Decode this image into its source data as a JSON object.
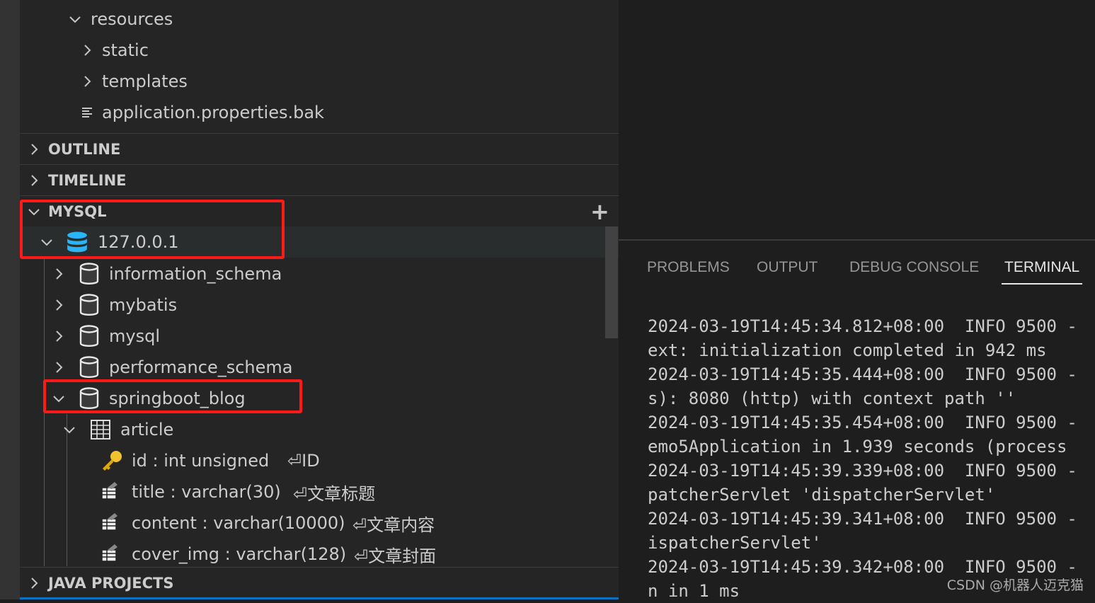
{
  "explorer": {
    "tree": [
      {
        "label": "resources",
        "state": "expanded"
      },
      {
        "label": "static",
        "state": "collapsed"
      },
      {
        "label": "templates",
        "state": "collapsed"
      },
      {
        "label": "application.properties.bak",
        "icon": "file-lines-icon"
      }
    ]
  },
  "sections": {
    "outline": "OUTLINE",
    "timeline": "TIMELINE",
    "mysql": "MYSQL",
    "java_projects": "JAVA PROJECTS"
  },
  "mysql": {
    "connection": "127.0.0.1",
    "databases": [
      "information_schema",
      "mybatis",
      "mysql",
      "performance_schema",
      "springboot_blog"
    ],
    "table": "article",
    "columns": [
      {
        "name": "id : int unsigned",
        "comment": "⏎ID",
        "icon": "key-icon"
      },
      {
        "name": "title : varchar(30)",
        "comment": "⏎文章标题",
        "icon": "column-icon"
      },
      {
        "name": "content : varchar(10000)",
        "comment": "⏎文章内容",
        "icon": "column-icon"
      },
      {
        "name": "cover_img : varchar(128)",
        "comment": "⏎文章封面",
        "icon": "column-icon"
      }
    ],
    "add_label": "+"
  },
  "panel": {
    "tabs": [
      "PROBLEMS",
      "OUTPUT",
      "DEBUG CONSOLE",
      "TERMINAL"
    ],
    "active_tab": "TERMINAL",
    "terminal_lines": [
      "2024-03-19T14:45:34.812+08:00  INFO 9500 -",
      "ext: initialization completed in 942 ms",
      "2024-03-19T14:45:35.444+08:00  INFO 9500 -",
      "s): 8080 (http) with context path ''",
      "2024-03-19T14:45:35.454+08:00  INFO 9500 -",
      "emo5Application in 1.939 seconds (process",
      "2024-03-19T14:45:39.339+08:00  INFO 9500 -",
      "patcherServlet 'dispatcherServlet'",
      "2024-03-19T14:45:39.341+08:00  INFO 9500 -",
      "ispatcherServlet'",
      "2024-03-19T14:45:39.342+08:00  INFO 9500 -",
      "n in 1 ms"
    ]
  },
  "watermark": "CSDN @机器人迈克猫",
  "colors": {
    "highlight_box": "#ff1a1a",
    "db_icon": "#29b6f6",
    "sidebar_bg": "#252526",
    "panel_bg": "#1e1e1e"
  }
}
